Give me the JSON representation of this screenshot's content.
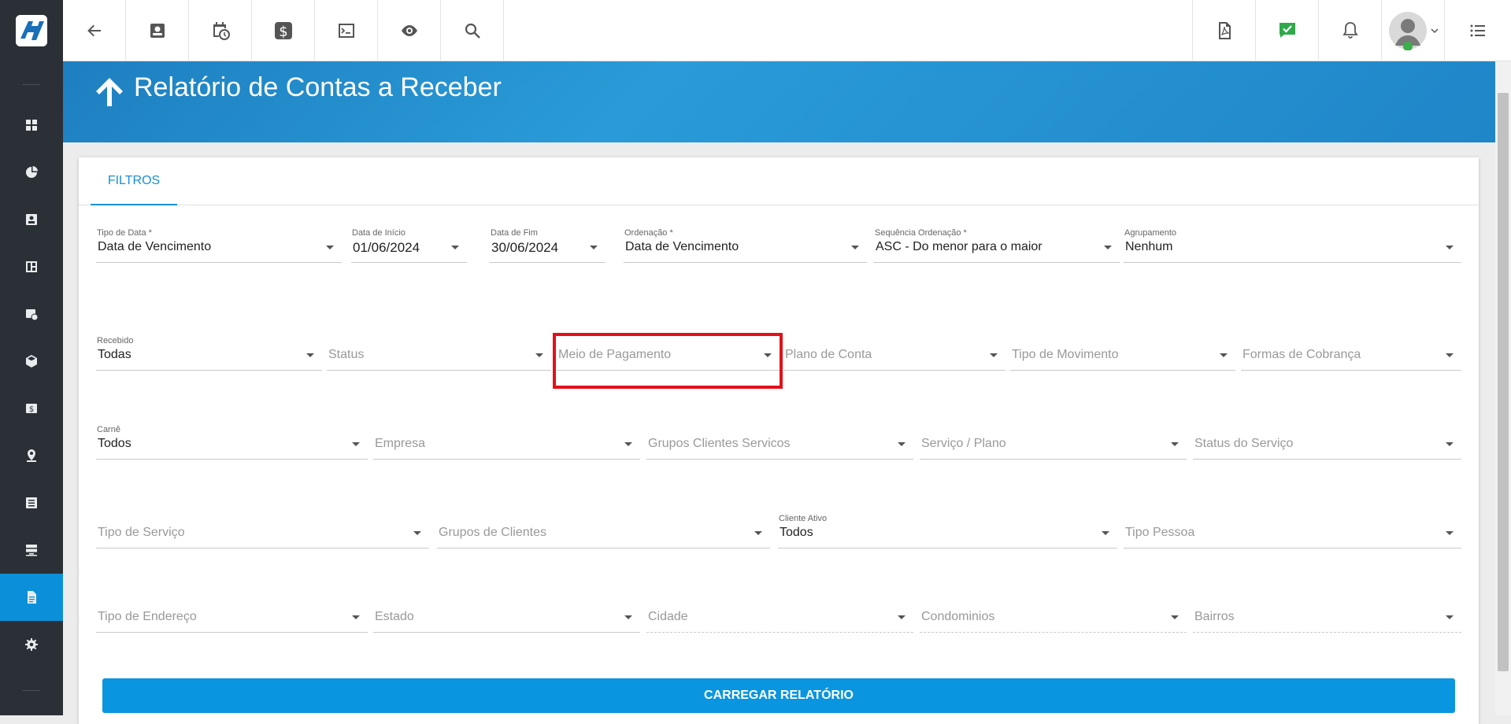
{
  "header": {
    "title": "Relatório de Contas a Receber"
  },
  "tabs": [
    {
      "label": "FILTROS"
    }
  ],
  "filters": {
    "row1": [
      {
        "label": "Tipo de Data *",
        "value": "Data de Vencimento"
      },
      {
        "label": "Data de Início",
        "value": "01/06/2024"
      },
      {
        "label": "Data de Fim",
        "value": "30/06/2024"
      },
      {
        "label": "Ordenação *",
        "value": "Data de Vencimento"
      },
      {
        "label": "Sequência Ordenação *",
        "value": "ASC - Do menor para o maior"
      },
      {
        "label": "Agrupamento",
        "value": "Nenhum"
      }
    ],
    "row2": [
      {
        "label": "Recebido",
        "value": "Todas"
      },
      {
        "placeholder": "Status"
      },
      {
        "placeholder": "Meio de Pagamento"
      },
      {
        "placeholder": "Plano de Conta"
      },
      {
        "placeholder": "Tipo de Movimento"
      },
      {
        "placeholder": "Formas de Cobrança"
      }
    ],
    "row3": [
      {
        "label": "Carnê",
        "value": "Todos"
      },
      {
        "placeholder": "Empresa"
      },
      {
        "placeholder": "Grupos Clientes Servicos"
      },
      {
        "placeholder": "Serviço / Plano"
      },
      {
        "placeholder": "Status do Serviço"
      }
    ],
    "row4": [
      {
        "placeholder": "Tipo de Serviço"
      },
      {
        "placeholder": "Grupos de Clientes"
      },
      {
        "label": "Cliente Ativo",
        "value": "Todos"
      },
      {
        "placeholder": "Tipo Pessoa"
      }
    ],
    "row5": [
      {
        "placeholder": "Tipo de Endereço"
      },
      {
        "placeholder": "Estado"
      },
      {
        "placeholder": "Cidade"
      },
      {
        "placeholder": "Condominios"
      },
      {
        "placeholder": "Bairros"
      }
    ]
  },
  "actions": {
    "load_report": "CARREGAR RELATÓRIO"
  },
  "colors": {
    "primary": "#0a95e0",
    "sidebar": "#2b3036",
    "highlight": "#e3101a"
  }
}
